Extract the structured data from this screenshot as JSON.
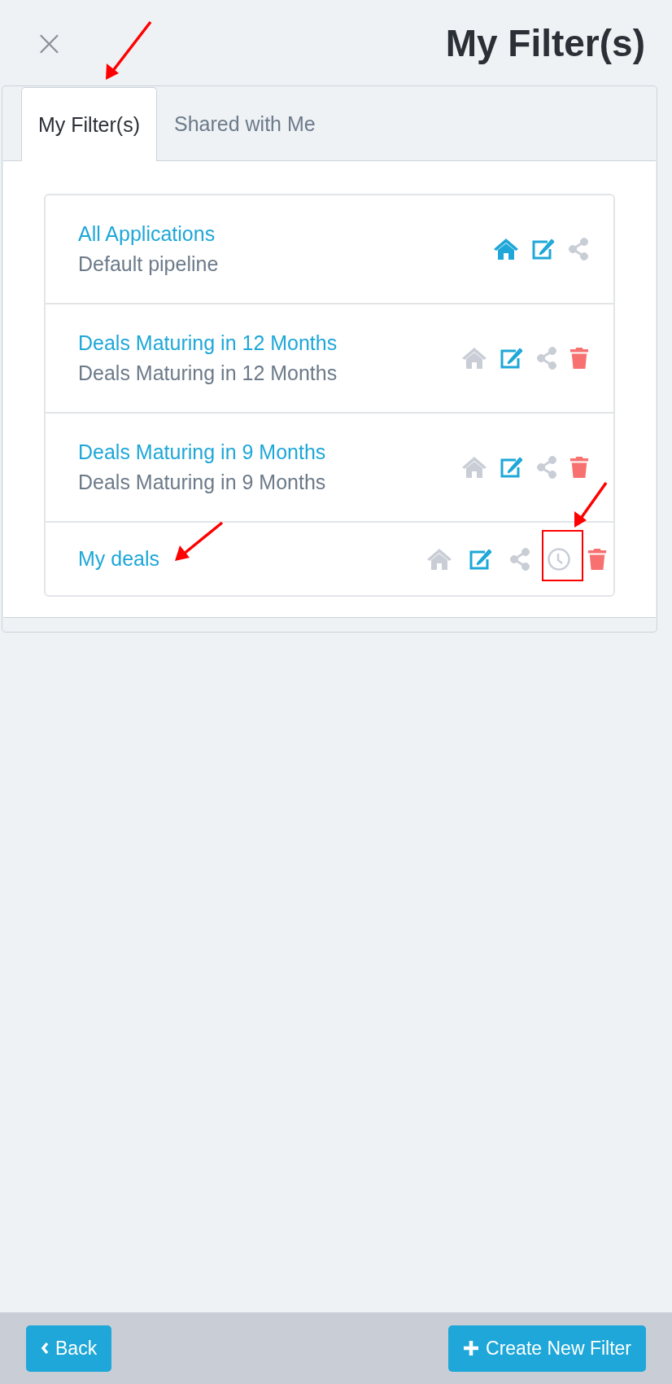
{
  "header": {
    "close": "×",
    "title": "My Filter(s)"
  },
  "tabs": [
    {
      "label": "My Filter(s)",
      "selected": true
    },
    {
      "label": "Shared with Me",
      "selected": false
    }
  ],
  "filters": [
    {
      "title": "All Applications",
      "subtitle": "Default pipeline",
      "default": true,
      "actions": [
        {
          "kind": "home"
        },
        {
          "kind": "edit"
        },
        {
          "kind": "share"
        }
      ]
    },
    {
      "title": "Deals Maturing in 12 Months",
      "subtitle": "Deals Maturing in 12 Months",
      "default": false,
      "actions": [
        {
          "kind": "home"
        },
        {
          "kind": "edit"
        },
        {
          "kind": "share"
        },
        {
          "kind": "delete"
        }
      ]
    },
    {
      "title": "Deals Maturing in 9 Months",
      "subtitle": "Deals Maturing in 9 Months",
      "default": false,
      "actions": [
        {
          "kind": "home"
        },
        {
          "kind": "edit"
        },
        {
          "kind": "share"
        },
        {
          "kind": "delete"
        }
      ]
    },
    {
      "title": "My deals",
      "default": false,
      "actions": [
        {
          "kind": "home"
        },
        {
          "kind": "edit"
        },
        {
          "kind": "share"
        },
        {
          "kind": "schedule"
        },
        {
          "kind": "delete"
        }
      ]
    }
  ],
  "footer": {
    "back": "Back",
    "create": "Create New Filter"
  }
}
